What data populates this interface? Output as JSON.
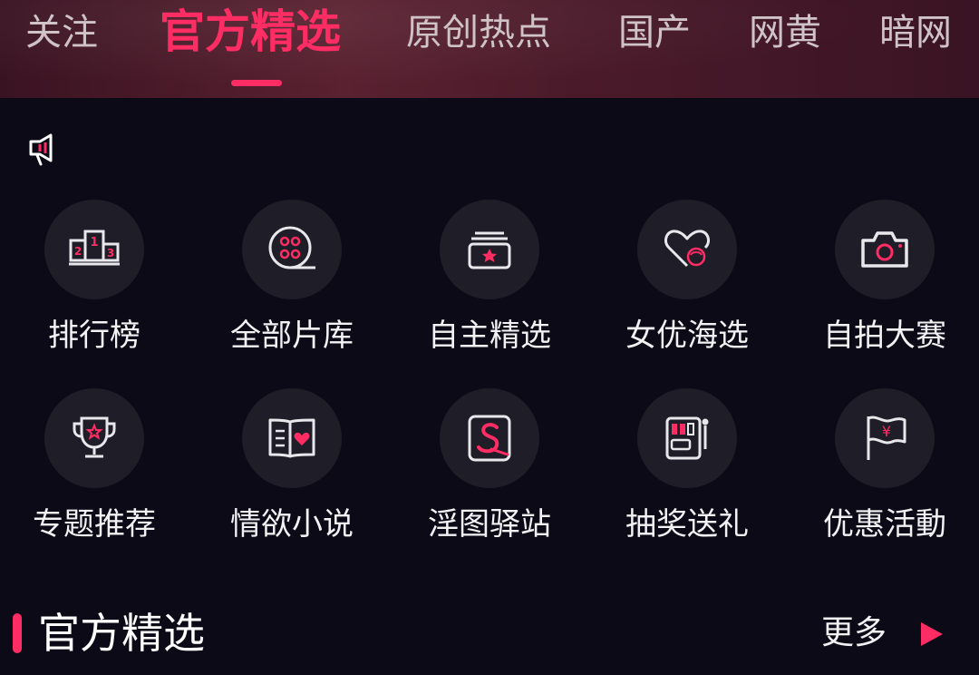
{
  "tabs": [
    {
      "label": "关注"
    },
    {
      "label": "官方精选"
    },
    {
      "label": "原创热点"
    },
    {
      "label": "国产"
    },
    {
      "label": "网黄"
    },
    {
      "label": "暗网"
    }
  ],
  "active_tab_index": 1,
  "notice": {
    "icon": "megaphone-icon"
  },
  "grid": [
    {
      "label": "排行榜",
      "icon": "podium-icon"
    },
    {
      "label": "全部片库",
      "icon": "film-reel-icon"
    },
    {
      "label": "自主精选",
      "icon": "star-box-icon"
    },
    {
      "label": "女优海选",
      "icon": "heart-face-icon"
    },
    {
      "label": "自拍大赛",
      "icon": "camera-icon"
    },
    {
      "label": "专题推荐",
      "icon": "trophy-icon"
    },
    {
      "label": "情欲小说",
      "icon": "book-heart-icon"
    },
    {
      "label": "淫图驿站",
      "icon": "picture-icon"
    },
    {
      "label": "抽奖送礼",
      "icon": "slot-machine-icon"
    },
    {
      "label": "优惠活動",
      "icon": "money-flag-icon"
    }
  ],
  "section": {
    "title": "官方精选",
    "more_label": "更多"
  },
  "colors": {
    "accent": "#ff2d63",
    "background": "#0b0a16",
    "circle": "#1e1d28"
  }
}
